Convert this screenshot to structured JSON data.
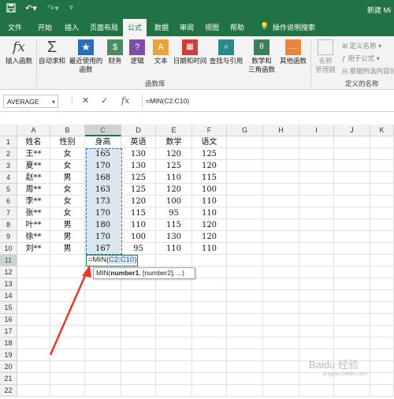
{
  "titlebar": {
    "title": "新建 Mi",
    "save_icon": "save-icon",
    "undo_icon": "undo-icon",
    "redo_icon": "redo-icon"
  },
  "tabs": [
    "文件",
    "开始",
    "插入",
    "页面布局",
    "公式",
    "数据",
    "审阅",
    "视图",
    "帮助"
  ],
  "tell_me": "操作说明搜索",
  "ribbon": {
    "insert_function": "插入函数",
    "autosum": "自动求和",
    "recent": "最近使用的\n函数",
    "financial": "财务",
    "logical": "逻辑",
    "text": "文本",
    "datetime": "日期和时间",
    "lookup": "查找与引用",
    "math": "数学和\n三角函数",
    "more": "其他函数",
    "group_library": "函数库",
    "name_manager": "名称\n管理器",
    "define_name": "定义名称",
    "use_in_formula": "用于公式",
    "create_from_selection": "根据所选内容创建",
    "group_defined_names": "定义的名称",
    "accent": "#217346"
  },
  "formula_bar": {
    "name_box": "AVERAGE",
    "formula": "=MIN(C2:C10)",
    "cancel": "✕",
    "enter": "✓",
    "fx": "fx"
  },
  "columns": [
    "A",
    "B",
    "C",
    "D",
    "E",
    "F",
    "G",
    "H",
    "I",
    "J",
    "K"
  ],
  "rows": [
    "1",
    "2",
    "3",
    "4",
    "5",
    "6",
    "7",
    "8",
    "9",
    "10",
    "11",
    "12",
    "13",
    "14",
    "15",
    "16",
    "17",
    "18",
    "19",
    "20",
    "21",
    "22"
  ],
  "table": {
    "headers": [
      "姓名",
      "性别",
      "身高",
      "英语",
      "数学",
      "语文"
    ],
    "data": [
      [
        "王**",
        "女",
        "165",
        "130",
        "120",
        "125"
      ],
      [
        "夏**",
        "女",
        "170",
        "130",
        "125",
        "120"
      ],
      [
        "赵**",
        "男",
        "168",
        "125",
        "110",
        "115"
      ],
      [
        "周**",
        "女",
        "163",
        "125",
        "120",
        "100"
      ],
      [
        "李**",
        "女",
        "173",
        "120",
        "100",
        "110"
      ],
      [
        "张**",
        "女",
        "170",
        "115",
        "95",
        "110"
      ],
      [
        "叶**",
        "男",
        "180",
        "110",
        "115",
        "120"
      ],
      [
        "徐**",
        "男",
        "170",
        "100",
        "130",
        "120"
      ],
      [
        "刘**",
        "男",
        "167",
        "95",
        "110",
        "110"
      ]
    ]
  },
  "edit_cell": {
    "prefix": "=MIN(",
    "ref": "C2:C10",
    "suffix": ")"
  },
  "tooltip": {
    "fn": "MIN(",
    "arg1": "number1",
    "rest": ", [number2], ...)"
  },
  "watermark": {
    "text": "Baidu 经验",
    "sub": "jingyan.baidu.com"
  },
  "arrow_color": "#e8372a"
}
